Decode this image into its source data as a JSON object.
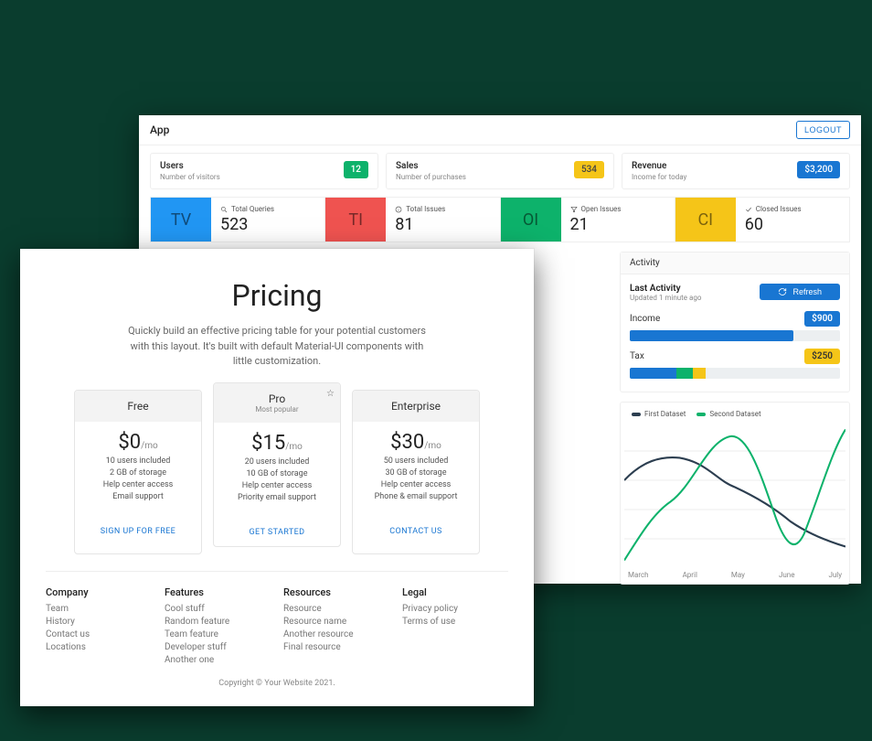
{
  "dashboard": {
    "app_label": "App",
    "logout": "LOGOUT",
    "cards": {
      "users": {
        "title": "Users",
        "sub": "Number of visitors",
        "badge": "12"
      },
      "sales": {
        "title": "Sales",
        "sub": "Number of purchases",
        "badge": "534"
      },
      "revenue": {
        "title": "Revenue",
        "sub": "Income for today",
        "badge": "$3,200"
      }
    },
    "stats": {
      "tq": {
        "abbr": "TV",
        "label": "Total Queries",
        "value": "523"
      },
      "ti": {
        "abbr": "TI",
        "label": "Total Issues",
        "value": "81"
      },
      "oi": {
        "abbr": "OI",
        "label": "Open Issues",
        "value": "21"
      },
      "ci": {
        "abbr": "CI",
        "label": "Closed Issues",
        "value": "60"
      }
    },
    "activity": {
      "header": "Activity",
      "last_activity": "Last Activity",
      "updated": "Updated 1 minute ago",
      "refresh": "Refresh",
      "income_label": "Income",
      "income_badge": "$900",
      "tax_label": "Tax",
      "tax_badge": "$250"
    },
    "chart_legend": {
      "s1": "First Dataset",
      "s2": "Second Dataset"
    },
    "chart_x": {
      "m1": "March",
      "m2": "April",
      "m3": "May",
      "m4": "June",
      "m5": "July"
    }
  },
  "pricing": {
    "title": "Pricing",
    "subtitle": "Quickly build an effective pricing table for your potential customers with this layout. It's built with default Material-UI components with little customization.",
    "plans": {
      "free": {
        "name": "Free",
        "price": "$0",
        "per": "/mo",
        "f1": "10 users included",
        "f2": "2 GB of storage",
        "f3": "Help center access",
        "f4": "Email support",
        "cta": "SIGN UP FOR FREE"
      },
      "pro": {
        "name": "Pro",
        "pop": "Most popular",
        "price": "$15",
        "per": "/mo",
        "f1": "20 users included",
        "f2": "10 GB of storage",
        "f3": "Help center access",
        "f4": "Priority email support",
        "cta": "GET STARTED"
      },
      "ent": {
        "name": "Enterprise",
        "price": "$30",
        "per": "/mo",
        "f1": "50 users included",
        "f2": "30 GB of storage",
        "f3": "Help center access",
        "f4": "Phone & email support",
        "cta": "CONTACT US"
      }
    },
    "footer": {
      "company": {
        "h": "Company",
        "l1": "Team",
        "l2": "History",
        "l3": "Contact us",
        "l4": "Locations"
      },
      "features": {
        "h": "Features",
        "l1": "Cool stuff",
        "l2": "Random feature",
        "l3": "Team feature",
        "l4": "Developer stuff",
        "l5": "Another one"
      },
      "resources": {
        "h": "Resources",
        "l1": "Resource",
        "l2": "Resource name",
        "l3": "Another resource",
        "l4": "Final resource"
      },
      "legal": {
        "h": "Legal",
        "l1": "Privacy policy",
        "l2": "Terms of use"
      }
    },
    "copyright": "Copyright © Your Website 2021."
  },
  "chart_data": {
    "type": "line",
    "x": [
      "March",
      "April",
      "May",
      "June",
      "July"
    ],
    "series": [
      {
        "name": "First Dataset",
        "color": "#2c3e50",
        "values": [
          60,
          75,
          55,
          32,
          15
        ]
      },
      {
        "name": "Second Dataset",
        "color": "#0db26b",
        "values": [
          5,
          45,
          90,
          20,
          95
        ]
      }
    ],
    "ylim": [
      0,
      100
    ]
  },
  "activity_bars": {
    "income": {
      "value": 900,
      "pct": 78
    },
    "tax": {
      "value": 250,
      "segments": [
        {
          "color": "#1976d2",
          "pct": 22
        },
        {
          "color": "#0db26b",
          "pct": 8
        },
        {
          "color": "#f5c518",
          "pct": 6
        },
        {
          "color": "#eceff1",
          "pct": 64
        }
      ]
    }
  }
}
